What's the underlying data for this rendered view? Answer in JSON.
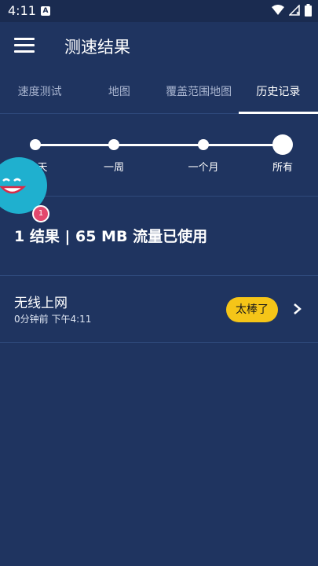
{
  "status_bar": {
    "time": "4:11",
    "notification": "A"
  },
  "app_bar": {
    "title": "测速结果"
  },
  "tabs": [
    {
      "label": "速度测试"
    },
    {
      "label": "地图"
    },
    {
      "label": "覆盖范围地图"
    },
    {
      "label": "历史记录"
    }
  ],
  "timeline": {
    "options": [
      "天",
      "一周",
      "一个月",
      "所有"
    ],
    "selected_index": 3
  },
  "mascot": {
    "badge_count": "1"
  },
  "summary": {
    "text": "1 结果 | 65 MB 流量已使用"
  },
  "results": [
    {
      "name": "无线上网",
      "time": "0分钟前 下午4:11",
      "rating": "太棒了"
    }
  ],
  "colors": {
    "background": "#1f3460",
    "status_bar": "#1a2b50",
    "rating_pill": "#f5c518",
    "mascot": "#1fb0cf",
    "badge": "#e2486d"
  }
}
